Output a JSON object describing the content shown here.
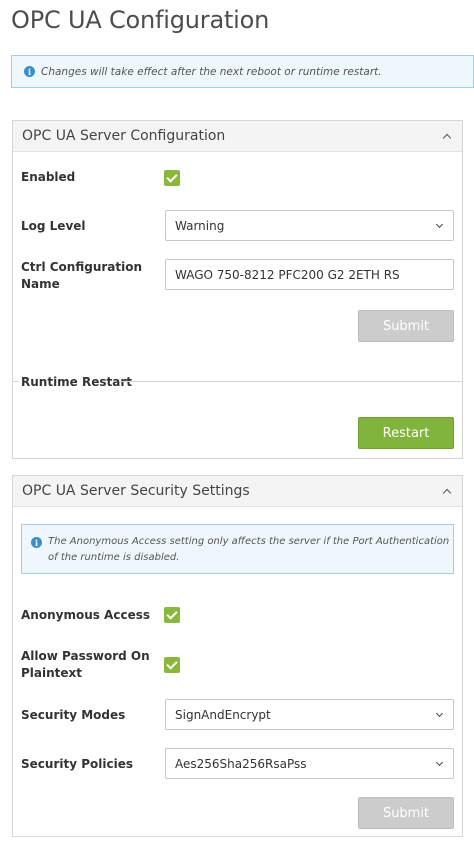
{
  "page": {
    "title": "OPC UA Configuration"
  },
  "notice": {
    "text": "Changes will take effect after the next reboot or runtime restart."
  },
  "server_config": {
    "title": "OPC UA Server Configuration",
    "enabled_label": "Enabled",
    "enabled": true,
    "log_level_label": "Log Level",
    "log_level_value": "Warning",
    "ctrl_name_label_line1": "Ctrl Configuration",
    "ctrl_name_label_line2": "Name",
    "ctrl_name_value": "WAGO 750-8212 PFC200 G2 2ETH RS",
    "submit_label": "Submit",
    "restart_section_label": "Runtime Restart",
    "restart_label": "Restart"
  },
  "security": {
    "title": "OPC UA Server Security Settings",
    "info_line1": "The Anonymous Access setting only affects the server if the Port Authentication",
    "info_line2": "of the runtime is disabled.",
    "anonymous_label": "Anonymous Access",
    "anonymous": true,
    "allow_password_label_line1": "Allow Password On",
    "allow_password_label_line2": "Plaintext",
    "allow_password": true,
    "modes_label": "Security Modes",
    "modes_value": "SignAndEncrypt",
    "policies_label": "Security Policies",
    "policies_value": "Aes256Sha256RsaPss",
    "submit_label": "Submit"
  },
  "colors": {
    "accent_green": "#80b43c",
    "checkbox_green": "#8ab83c",
    "info_blue": "#3b8fc6",
    "info_bg": "#eef8fc",
    "disabled_button": "#cccccc"
  },
  "icons": [
    "info-icon",
    "chevron-up-icon",
    "chevron-down-icon",
    "checkmark-icon"
  ]
}
